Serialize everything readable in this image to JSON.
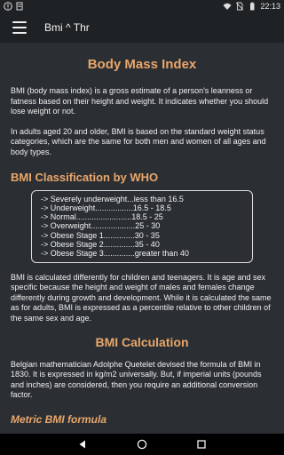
{
  "status_bar": {
    "time": "22:13"
  },
  "app_bar": {
    "title": "Bmi ^ Thr"
  },
  "content": {
    "title": "Body Mass Index",
    "intro_1": "BMI (body mass index) is a gross estimate of a person's leanness or fatness based on their height and weight. It indicates whether you should lose weight or not.",
    "intro_2": " In adults aged 20 and older, BMI is based on the standard weight status categories, which are the same for both men and women of all ages and body types.",
    "who_heading": "BMI Classification by WHO",
    "who_rows": [
      "-> Severely underweight...less than 16.5",
      "-> Underweight.................16.5 - 18.5",
      "-> Normal.........................18.5 - 25",
      "-> Overweight....................25 - 30",
      "-> Obese Stage 1..............30 - 35",
      "-> Obese Stage 2..............35 - 40",
      "-> Obese Stage 3..............greater than 40"
    ],
    "children_para": "BMI is calculated differently for children and teenagers. It is age and sex specific because the height and weight of males and females change differently during growth and development. While it is calculated the same as for adults, BMI is expressed as a percentile relative to other children of the same sex and age.",
    "calc_heading": "BMI Calculation",
    "calc_para": "Belgian mathematician Adolphe Quetelet devised the formula of BMI in 1830. It is expressed in kg/m2 universally. But, if imperial units (pounds and inches) are considered, then you require an additional conversion factor.",
    "metric_heading": "Metric BMI formula"
  }
}
